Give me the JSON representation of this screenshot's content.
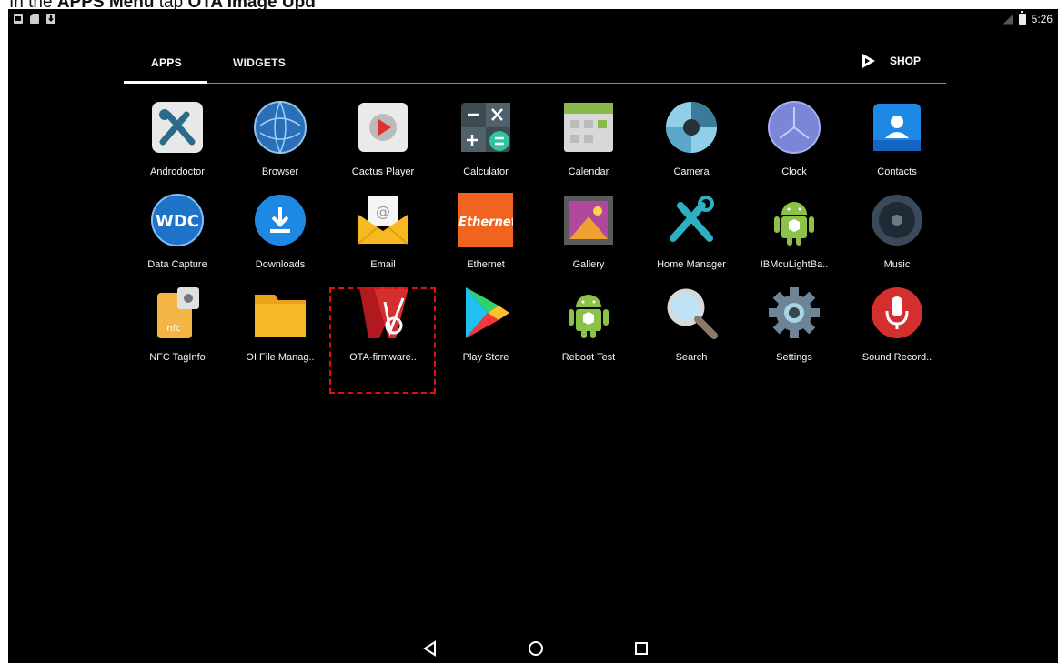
{
  "caption": {
    "pre": "In the ",
    "bold1": "APPS Menu",
    "mid": " tap ",
    "bold2": "OTA Image Upd"
  },
  "status_bar": {
    "time": "5:26",
    "left_icons": [
      "picture-icon",
      "sd-card-icon",
      "download-icon"
    ],
    "right_icons": [
      "signal-icon",
      "battery-icon"
    ]
  },
  "tabs": {
    "apps": "APPS",
    "widgets": "WIDGETS",
    "shop": "SHOP",
    "active": "APPS"
  },
  "apps": [
    {
      "label": "Androdoctor",
      "icon": "androdoctor-icon"
    },
    {
      "label": "Browser",
      "icon": "browser-icon"
    },
    {
      "label": "Cactus Player",
      "icon": "cactus-player-icon"
    },
    {
      "label": "Calculator",
      "icon": "calculator-icon"
    },
    {
      "label": "Calendar",
      "icon": "calendar-icon"
    },
    {
      "label": "Camera",
      "icon": "camera-icon"
    },
    {
      "label": "Clock",
      "icon": "clock-icon"
    },
    {
      "label": "Contacts",
      "icon": "contacts-icon"
    },
    {
      "label": "Data Capture",
      "icon": "data-capture-icon",
      "icon_text": "WDC"
    },
    {
      "label": "Downloads",
      "icon": "downloads-icon"
    },
    {
      "label": "Email",
      "icon": "email-icon"
    },
    {
      "label": "Ethernet",
      "icon": "ethernet-icon",
      "icon_text": "Ethernet"
    },
    {
      "label": "Gallery",
      "icon": "gallery-icon"
    },
    {
      "label": "Home Manager",
      "icon": "home-manager-icon"
    },
    {
      "label": "IBMcuLightBa..",
      "icon": "android-robot-icon"
    },
    {
      "label": "Music",
      "icon": "music-icon"
    },
    {
      "label": "NFC TagInfo",
      "icon": "nfc-taginfo-icon",
      "icon_text": "nfc"
    },
    {
      "label": "OI File Manag..",
      "icon": "folder-icon"
    },
    {
      "label": "OTA-firmware..",
      "icon": "ota-firmware-icon"
    },
    {
      "label": "Play Store",
      "icon": "play-store-icon"
    },
    {
      "label": "Reboot Test",
      "icon": "android-robot-icon"
    },
    {
      "label": "Search",
      "icon": "search-icon"
    },
    {
      "label": "Settings",
      "icon": "settings-icon"
    },
    {
      "label": "Sound Record..",
      "icon": "microphone-icon"
    }
  ],
  "highlighted_app": "OTA-firmware..",
  "nav": [
    "back-icon",
    "home-icon",
    "recents-icon"
  ],
  "colors": {
    "background": "#000000",
    "highlight_border": "#dd1111",
    "text": "#ffffff"
  }
}
